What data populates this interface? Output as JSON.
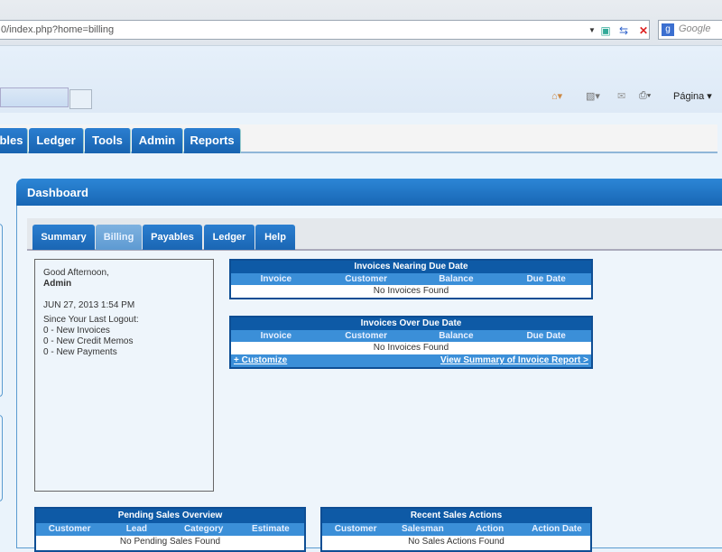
{
  "browser": {
    "url": "0/index.php?home=billing",
    "search_placeholder": "Google",
    "page_menu": "Página ▾"
  },
  "nav": {
    "tabs": [
      "bles",
      "Ledger",
      "Tools",
      "Admin",
      "Reports"
    ]
  },
  "dashboard": {
    "title": "Dashboard",
    "tabs": [
      "Summary",
      "Billing",
      "Payables",
      "Ledger",
      "Help"
    ],
    "active_tab": "Billing"
  },
  "welcome": {
    "greeting": "Good Afternoon,",
    "user": "Admin",
    "datetime": "JUN 27, 2013 1:54 PM",
    "since": "Since Your Last Logout:",
    "items": [
      "0 - New Invoices",
      "0 - New Credit Memos",
      "0 - New Payments"
    ]
  },
  "tables": {
    "nearing": {
      "title": "Invoices Nearing Due Date",
      "columns": [
        "Invoice",
        "Customer",
        "Balance",
        "Due Date"
      ],
      "empty": "No Invoices Found"
    },
    "over": {
      "title": "Invoices Over Due Date",
      "columns": [
        "Invoice",
        "Customer",
        "Balance",
        "Due Date"
      ],
      "empty": "No Invoices Found",
      "customize": "+ Customize",
      "report_link": "View Summary of Invoice Report >"
    },
    "pending": {
      "title": "Pending Sales Overview",
      "columns": [
        "Customer",
        "Lead",
        "Category",
        "Estimate"
      ],
      "empty": "No Pending Sales Found"
    },
    "recent": {
      "title": "Recent Sales Actions",
      "columns": [
        "Customer",
        "Salesman",
        "Action",
        "Action Date"
      ],
      "empty": "No Sales Actions Found"
    }
  }
}
